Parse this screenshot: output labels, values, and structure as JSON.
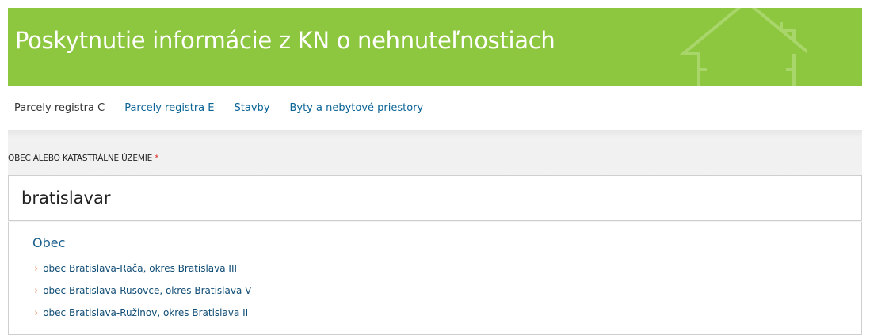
{
  "header": {
    "title": "Poskytnutie informácie z KN o nehnuteľnostiach",
    "background_color": "#8dc63f"
  },
  "tabs": [
    {
      "label": "Parcely registra C",
      "active": true
    },
    {
      "label": "Parcely registra E",
      "active": false
    },
    {
      "label": "Stavby",
      "active": false
    },
    {
      "label": "Byty a nebytové priestory",
      "active": false
    }
  ],
  "form": {
    "field_label": "OBEC ALEBO KATASTRÁLNE ÚZEMIE",
    "required_marker": "*",
    "search_value": "bratislavar"
  },
  "dropdown": {
    "group_title": "Obec",
    "items": [
      {
        "label": "obec Bratislava-Rača, okres Bratislava III"
      },
      {
        "label": "obec Bratislava-Rusovce, okres Bratislava V"
      },
      {
        "label": "obec Bratislava-Ružinov, okres Bratislava II"
      }
    ],
    "chevron_glyph": "›",
    "chevron_icon": "chevron-right-icon"
  }
}
